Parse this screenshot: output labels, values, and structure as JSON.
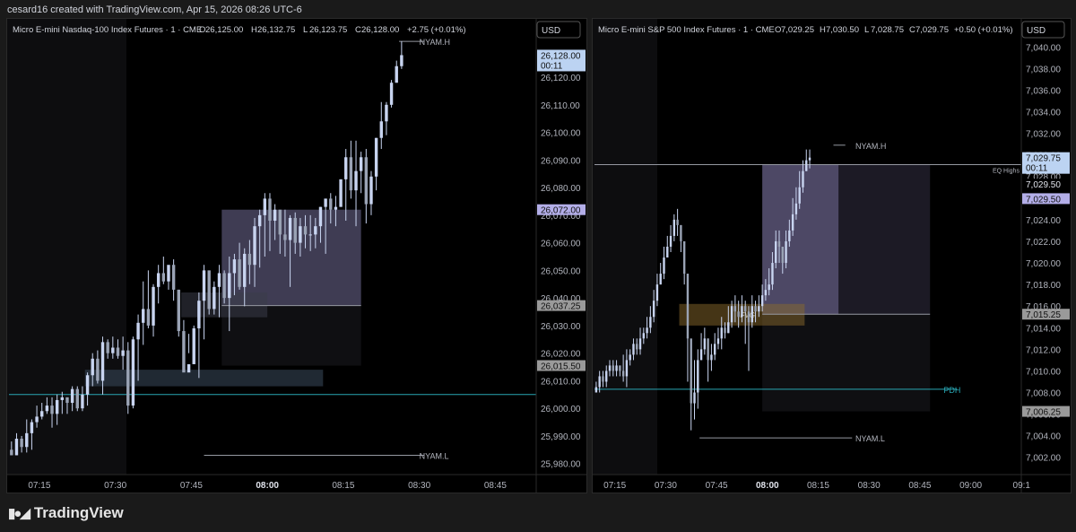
{
  "header": {
    "credit": "cesard16 created with TradingView.com, Apr 15, 2026 08:26 UTC-6"
  },
  "footer": {
    "brand": "TradingView",
    "logo_icon": "tradingview-logo-icon"
  },
  "colors": {
    "background": "#000000",
    "frame": "#1a1a1a",
    "candle": "#c8d4f0",
    "text": "#d1d4dc",
    "axis_text": "#b2b5be",
    "teal_line": "#29a6b3",
    "zone_purple": "#8c84b8",
    "zone_gray": "#3a3d48",
    "zone_blue": "#3a4a5c",
    "zone_tan": "#8a6a2c",
    "label_blue_bg": "#bcd3f2",
    "label_purple_bg": "#b3aee8",
    "label_gray_bg": "#9a9a9a"
  },
  "chart_data": [
    {
      "type": "candlestick",
      "title": "Micro E-mini Nasdaq-100 Index Futures · 1 · CME",
      "ohlc_header": {
        "O": "26,125.00",
        "H": "26,132.75",
        "L": "26,123.75",
        "C": "26,128.00",
        "change": "+2.75 (+0.01%)"
      },
      "currency_label": "USD",
      "x_range_min": [
        0,
        78
      ],
      "ylim": [
        25976,
        26134
      ],
      "x_ticks": [
        {
          "min": 6,
          "label": "07:15"
        },
        {
          "min": 21,
          "label": "07:30"
        },
        {
          "min": 36,
          "label": "07:45"
        },
        {
          "min": 51,
          "label": "08:00"
        },
        {
          "min": 66,
          "label": "08:15"
        },
        {
          "min": 81,
          "label": "08:30"
        },
        {
          "min": 96,
          "label": "08:45"
        }
      ],
      "y_ticks": [
        "25,980.00",
        "25,990.00",
        "26,000.00",
        "26,010.00",
        "26,020.00",
        "26,030.00",
        "26,040.00",
        "26,050.00",
        "26,060.00",
        "26,070.00",
        "26,080.00",
        "26,090.00",
        "26,100.00",
        "26,110.00",
        "26,120.00"
      ],
      "price_labels": [
        {
          "price": 26128.0,
          "text": "26,128.00",
          "sub": "00:11",
          "style": "blue"
        },
        {
          "price": 26072.0,
          "text": "26,072.00",
          "style": "purple"
        },
        {
          "price": 26037.25,
          "text": "26,037.25",
          "style": "gray"
        },
        {
          "price": 26015.5,
          "text": "26,015.50",
          "style": "gray"
        }
      ],
      "candles_close_start": 25985,
      "candle_closes": [
        25983,
        25989,
        25986,
        25991,
        25995,
        25997,
        25999,
        26001,
        25998,
        26003,
        26004,
        26002,
        26007,
        26000,
        26005,
        26012,
        26018,
        26010,
        26024,
        26020,
        26022,
        26019,
        26021,
        26001,
        26025,
        26031,
        26036,
        26030,
        26044,
        26049,
        26046,
        26052,
        26043,
        26028,
        26013,
        26016,
        26029,
        26039,
        26050,
        26036,
        26044,
        26049,
        26040,
        26049,
        26054,
        26044,
        26056,
        26052,
        26066,
        26070,
        26076,
        26068,
        26072,
        26063,
        26061,
        26069,
        26060,
        26066,
        26063,
        26063,
        26066,
        26073,
        26076,
        26072,
        26073,
        26083,
        26091,
        26079,
        26086,
        26091,
        26074,
        26084,
        26098,
        26104,
        26110,
        26118,
        26124,
        26128
      ],
      "candle_lows": [
        25983,
        25983,
        25984,
        25984,
        25985,
        25993,
        25996,
        25998,
        25993,
        25994,
        25998,
        25998,
        25999,
        25999,
        25999,
        26001,
        26008,
        26009,
        26005,
        26018,
        26018,
        26018,
        26014,
        25998,
        26000,
        26010,
        26023,
        26029,
        26026,
        26038,
        26045,
        26043,
        26039,
        26026,
        26024,
        26020,
        26022,
        26011,
        26025,
        26034,
        26034,
        26033,
        26038,
        26028,
        26041,
        26043,
        26037,
        26045,
        26044,
        26051,
        26055,
        26057,
        26061,
        26056,
        26055,
        26044,
        26056,
        26055,
        26058,
        26057,
        26058,
        26060,
        26056,
        26067,
        26066,
        26073,
        26068,
        26076,
        26066,
        26078,
        26067,
        26070,
        26079,
        26094,
        26099,
        26109,
        26118,
        26123
      ],
      "candle_highs": [
        25988,
        25991,
        25990,
        25996,
        25996,
        26001,
        26002,
        26004,
        26004,
        26005,
        26006,
        26004,
        26008,
        26008,
        26008,
        26013,
        26020,
        26021,
        26026,
        26025,
        26026,
        26025,
        26026,
        26024,
        26026,
        26034,
        26046,
        26050,
        26045,
        26052,
        26055,
        26051,
        26054,
        26043,
        26032,
        26027,
        26030,
        26042,
        26052,
        26046,
        26046,
        26052,
        26050,
        26055,
        26056,
        26060,
        26058,
        26061,
        26069,
        26072,
        26078,
        26078,
        26074,
        26070,
        26072,
        26070,
        26071,
        26069,
        26070,
        26070,
        26069,
        26073,
        26076,
        26078,
        26077,
        26083,
        26094,
        26097,
        26097,
        26093,
        26094,
        26086,
        26098,
        26111,
        26111,
        26119,
        26126,
        26133
      ],
      "lines": [
        {
          "name": "nyam-high",
          "price": 26133,
          "x_min": [
            77,
            82
          ],
          "label": "NYAM.H",
          "label_x_min": 81
        },
        {
          "name": "nyam-low",
          "price": 25983,
          "x_min": [
            38.5,
            82
          ],
          "label": "NYAM.L",
          "label_x_min": 81
        },
        {
          "name": "teal-level",
          "price": 26005,
          "x_min": [
            0,
            999
          ],
          "color": "teal"
        },
        {
          "name": "mid-level",
          "price": 26037.25,
          "x_min": [
            42,
            69.5
          ]
        }
      ],
      "zones": [
        {
          "name": "purple-zone",
          "x_min": [
            42,
            69.5
          ],
          "price": [
            26037.25,
            26072
          ],
          "color": "purple",
          "opacity": 0.45
        },
        {
          "name": "lower-zone",
          "x_min": [
            42,
            69.5
          ],
          "price": [
            26015.5,
            26037.25
          ],
          "color": "gray",
          "opacity": 0.25
        },
        {
          "name": "small-gray-zone",
          "x_min": [
            34,
            51
          ],
          "price": [
            26033,
            26042
          ],
          "color": "gray",
          "opacity": 0.55
        },
        {
          "name": "blue-zone",
          "x_min": [
            15,
            62
          ],
          "price": [
            26008,
            26014
          ],
          "color": "blue",
          "opacity": 0.55
        }
      ]
    },
    {
      "type": "candlestick",
      "title": "Micro E-mini S&P 500 Index Futures · 1 · CME",
      "ohlc_header": {
        "O": "7,029.25",
        "H": "7,030.50",
        "L": "7,028.75",
        "C": "7,029.75",
        "change": "+0.50 (+0.01%)"
      },
      "currency_label": "USD",
      "x_range_min": [
        0,
        78
      ],
      "ylim": [
        7000.4,
        7041.6
      ],
      "x_ticks": [
        {
          "min": 6,
          "label": "07:15"
        },
        {
          "min": 21,
          "label": "07:30"
        },
        {
          "min": 36,
          "label": "07:45"
        },
        {
          "min": 51,
          "label": "08:00"
        },
        {
          "min": 66,
          "label": "08:15"
        },
        {
          "min": 81,
          "label": "08:30"
        },
        {
          "min": 96,
          "label": "08:45"
        },
        {
          "min": 111,
          "label": "09:00"
        },
        {
          "min": 126,
          "label": "09:1"
        }
      ],
      "y_ticks": [
        "7,002.00",
        "7,004.00",
        "7,006.00",
        "7,008.00",
        "7,010.00",
        "7,012.00",
        "7,014.00",
        "7,016.00",
        "7,018.00",
        "7,020.00",
        "7,022.00",
        "7,024.00",
        "7,026.00",
        "7,028.00",
        "7,030.00",
        "7,032.00",
        "7,034.00",
        "7,036.00",
        "7,038.00",
        "7,040.00"
      ],
      "price_labels": [
        {
          "price": 7029.75,
          "text": "7,029.75",
          "sub": "00:11",
          "style": "blue"
        },
        {
          "price": 7027.3,
          "text": "7,029.50",
          "style": "plain"
        },
        {
          "price": 7025.95,
          "text": "7,029.50",
          "style": "purple"
        },
        {
          "price": 7015.25,
          "text": "7,015.25",
          "style": "gray"
        },
        {
          "price": 7006.25,
          "text": "7,006.25",
          "style": "gray"
        }
      ],
      "candles_close_start": 7008,
      "candle_closes": [
        7008.5,
        7009.5,
        7009,
        7010,
        7010.5,
        7010,
        7010.5,
        7010,
        7009.5,
        7011,
        7011.5,
        7012.5,
        7012,
        7013,
        7013.5,
        7014,
        7015,
        7016.5,
        7018,
        7019,
        7020.5,
        7021.5,
        7022.5,
        7024,
        7023.5,
        7022,
        7019,
        7013,
        7007,
        7008,
        7011,
        7012,
        7013,
        7011,
        7011.5,
        7012.5,
        7013,
        7014,
        7013.5,
        7014.5,
        7016,
        7015.5,
        7015,
        7016,
        7015.5,
        7014.5,
        7016,
        7015.5,
        7016,
        7017,
        7017.5,
        7018,
        7020,
        7022,
        7021.5,
        7020,
        7022,
        7023,
        7024.5,
        7025.5,
        7027,
        7028.5,
        7029.5,
        7029.75
      ],
      "candle_lows": [
        7008,
        7008,
        7008.5,
        7008.5,
        7009.5,
        7009.5,
        7009.5,
        7009.5,
        7009,
        7008.5,
        7010.5,
        7011,
        7011.5,
        7011.5,
        7012.5,
        7013,
        7013.5,
        7014.5,
        7016,
        7018,
        7018.5,
        7020.5,
        7021,
        7022,
        7022.5,
        7021,
        7018,
        7009,
        7004.5,
        7005.5,
        7006.5,
        7011,
        7011.5,
        7009,
        7010,
        7011,
        7012,
        7012,
        7013,
        7013.5,
        7014,
        7014.5,
        7014,
        7014.5,
        7012.5,
        7010,
        7014,
        7014.5,
        7015,
        7015.5,
        7016.5,
        7017,
        7017.5,
        7019.5,
        7020,
        7019,
        7019.5,
        7021.5,
        7022.5,
        7024,
        7025,
        7026.5,
        7028.5,
        7028.75
      ],
      "candle_highs": [
        7009,
        7010,
        7010,
        7010.5,
        7011,
        7011,
        7011,
        7010.5,
        7011.5,
        7012,
        7012,
        7013,
        7013,
        7014,
        7014,
        7015,
        7016,
        7017.5,
        7019,
        7020,
        7021.5,
        7022.5,
        7023.5,
        7024.5,
        7025,
        7023.5,
        7022,
        7019,
        7012,
        7011,
        7012,
        7013.5,
        7014,
        7013,
        7012.5,
        7013.5,
        7014,
        7015,
        7014.5,
        7016,
        7016.5,
        7017,
        7016.5,
        7017,
        7016.5,
        7016,
        7017,
        7016.5,
        7017,
        7018,
        7018.5,
        7019.5,
        7021,
        7023,
        7023,
        7021.5,
        7023,
        7024,
        7026,
        7027,
        7028.5,
        7029.5,
        7030.5,
        7030.5
      ],
      "lines": [
        {
          "name": "nyam-high",
          "price": 7030.9,
          "x_min": [
            70.5,
            74
          ],
          "label": "NYAM.H",
          "label_x_min": 77
        },
        {
          "name": "nyam-low",
          "price": 7003.8,
          "x_min": [
            31,
            76
          ],
          "label": "NYAM.L",
          "label_x_min": 77
        },
        {
          "name": "eq-highs",
          "price": 7029.1,
          "x_min": [
            0,
            999
          ],
          "label": "EQ Highs",
          "label_x_min": 116
        },
        {
          "name": "pdh-line",
          "price": 7008.3,
          "x_min": [
            0,
            107
          ],
          "color": "teal",
          "label": "PDH",
          "label_x_min": 103
        },
        {
          "name": "mid-level",
          "price": 7015.25,
          "x_min": [
            49.5,
            99
          ]
        }
      ],
      "zones": [
        {
          "name": "purple-zone",
          "x_min": [
            49.5,
            72
          ],
          "price": [
            7015.25,
            7029.1
          ],
          "color": "purple",
          "opacity": 0.55
        },
        {
          "name": "purple-zone-ext",
          "x_min": [
            72,
            99
          ],
          "price": [
            7015.25,
            7029.1
          ],
          "color": "purple",
          "opacity": 0.2
        },
        {
          "name": "lower-zone",
          "x_min": [
            49.5,
            99
          ],
          "price": [
            7006.25,
            7015.25
          ],
          "color": "gray",
          "opacity": 0.25
        },
        {
          "name": "fvg-zone",
          "x_min": [
            25,
            62
          ],
          "price": [
            7014.2,
            7016.2
          ],
          "color": "tan",
          "opacity": 0.5,
          "label": "FVG"
        }
      ]
    }
  ]
}
